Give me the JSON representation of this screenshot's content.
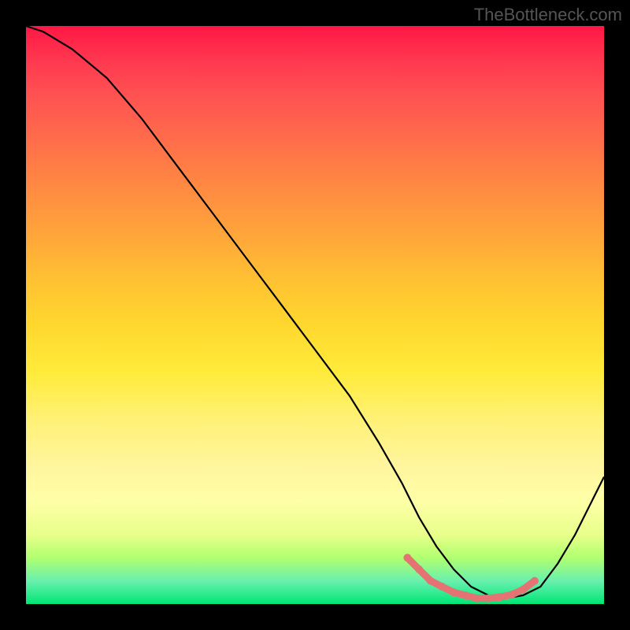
{
  "watermark": "TheBottleneck.com",
  "chart_data": {
    "type": "line",
    "title": "",
    "xlabel": "",
    "ylabel": "",
    "xlim": [
      0,
      100
    ],
    "ylim": [
      0,
      100
    ],
    "series": [
      {
        "name": "bottleneck-curve",
        "x": [
          0,
          3,
          8,
          14,
          20,
          26,
          32,
          38,
          44,
          50,
          56,
          61,
          65,
          68,
          71,
          74,
          77,
          80,
          83,
          86,
          89,
          92,
          95,
          98,
          100
        ],
        "values": [
          100,
          99,
          96,
          91,
          84,
          76,
          68,
          60,
          52,
          44,
          36,
          28,
          21,
          15,
          10,
          6,
          3,
          1.5,
          1,
          1.5,
          3,
          7,
          12,
          18,
          22
        ]
      }
    ],
    "markers": {
      "name": "optimal-range",
      "x": [
        66,
        68,
        70,
        72,
        74,
        76,
        78,
        80,
        82,
        84,
        86,
        88
      ],
      "values": [
        8,
        6,
        4,
        3,
        2,
        1.5,
        1,
        1,
        1.2,
        1.6,
        2.5,
        4
      ]
    },
    "colors": {
      "curve": "#000000",
      "markers": "#e57373",
      "gradient_top": "#ff1744",
      "gradient_bottom": "#00e676"
    }
  }
}
